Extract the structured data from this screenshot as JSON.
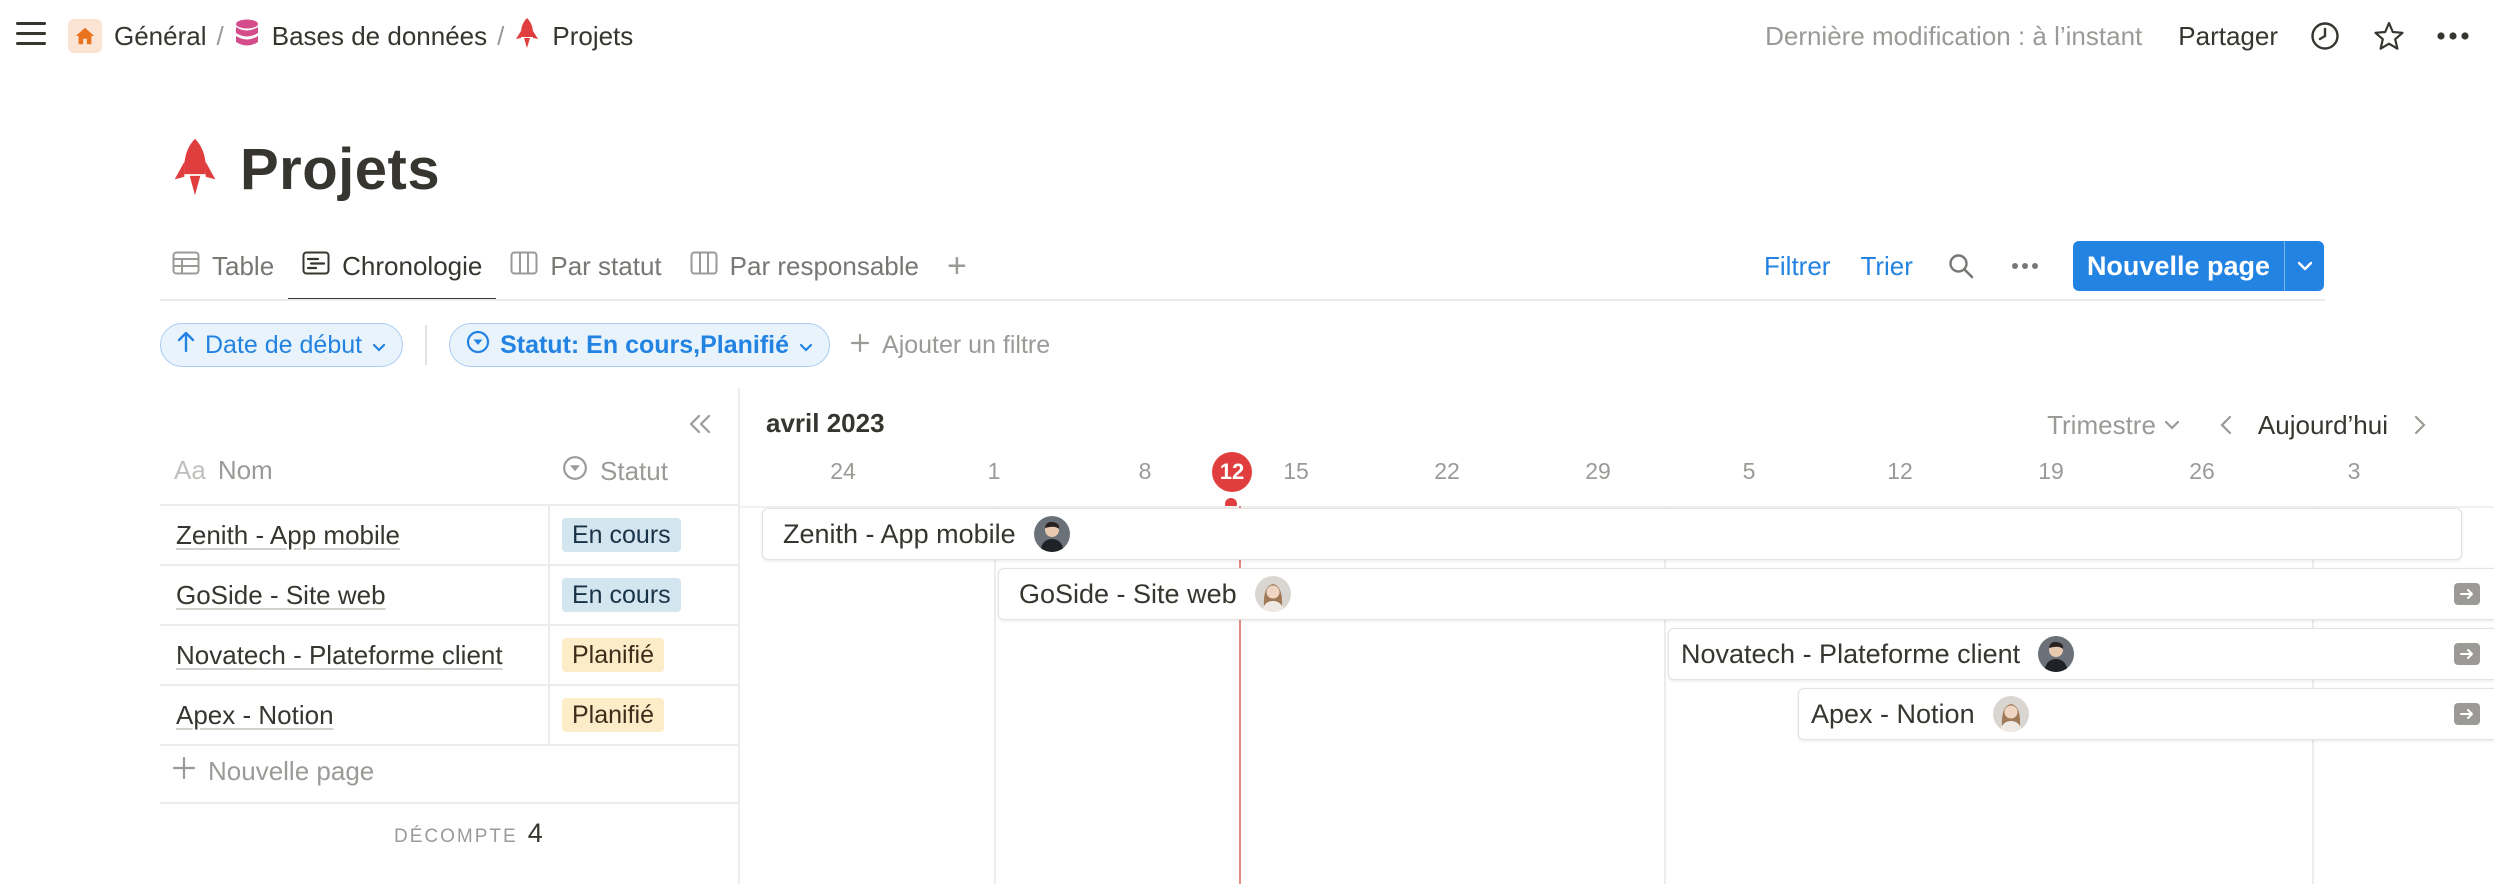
{
  "breadcrumb": {
    "items": [
      {
        "label": "Général",
        "icon": "home-icon"
      },
      {
        "label": "Bases de données",
        "icon": "database-icon"
      },
      {
        "label": "Projets",
        "icon": "rocket-icon"
      }
    ],
    "separator": "/"
  },
  "topbar": {
    "last_modified": "Dernière modification : à l’instant",
    "share_label": "Partager",
    "icons": [
      "history-icon",
      "star-icon",
      "more-icon"
    ]
  },
  "page": {
    "title": "Projets",
    "icon": "rocket-icon",
    "icon_color": "#e03e3e"
  },
  "views": {
    "tabs": [
      {
        "label": "Table",
        "icon": "table-icon",
        "active": false
      },
      {
        "label": "Chronologie",
        "icon": "timeline-icon",
        "active": true
      },
      {
        "label": "Par statut",
        "icon": "board-icon",
        "active": false
      },
      {
        "label": "Par responsable",
        "icon": "board-icon",
        "active": false
      }
    ],
    "add_icon": "plus-icon"
  },
  "toolbar": {
    "filter_label": "Filtrer",
    "sort_label": "Trier",
    "new_page_label": "Nouvelle page",
    "accent": "#2383e2"
  },
  "filters": {
    "sort_chip": "Date de début",
    "status_chip": "Statut: En cours,Planifié",
    "add_filter": "Ajouter un filtre"
  },
  "table": {
    "columns": [
      {
        "label": "Nom",
        "icon_text": "Aa"
      },
      {
        "label": "Statut",
        "icon": "status-icon"
      }
    ],
    "rows": [
      {
        "name": "Zenith - App mobile",
        "status": "En cours",
        "status_color": "blue"
      },
      {
        "name": "GoSide - Site web",
        "status": "En cours",
        "status_color": "blue"
      },
      {
        "name": "Novatech - Plateforme client",
        "status": "Planifié",
        "status_color": "yellow"
      },
      {
        "name": "Apex - Notion",
        "status": "Planifié",
        "status_color": "yellow"
      }
    ],
    "new_page_label": "Nouvelle page",
    "count_label": "DÉCOMPTE",
    "count_value": "4"
  },
  "timeline": {
    "month": "avril 2023",
    "scale": "Trimestre",
    "today_label": "Aujourd’hui",
    "ticks": [
      "24",
      "1",
      "8",
      "15",
      "22",
      "29",
      "5",
      "12",
      "19",
      "26",
      "3"
    ],
    "today": "12",
    "today_color": "#e03e3e",
    "bars": [
      {
        "name": "Zenith - App mobile",
        "avatar": "man",
        "overflow": false
      },
      {
        "name": "GoSide - Site web",
        "avatar": "woman",
        "overflow": true
      },
      {
        "name": "Novatech - Plateforme client",
        "avatar": "man",
        "overflow": true
      },
      {
        "name": "Apex - Notion",
        "avatar": "woman",
        "overflow": true
      }
    ]
  }
}
